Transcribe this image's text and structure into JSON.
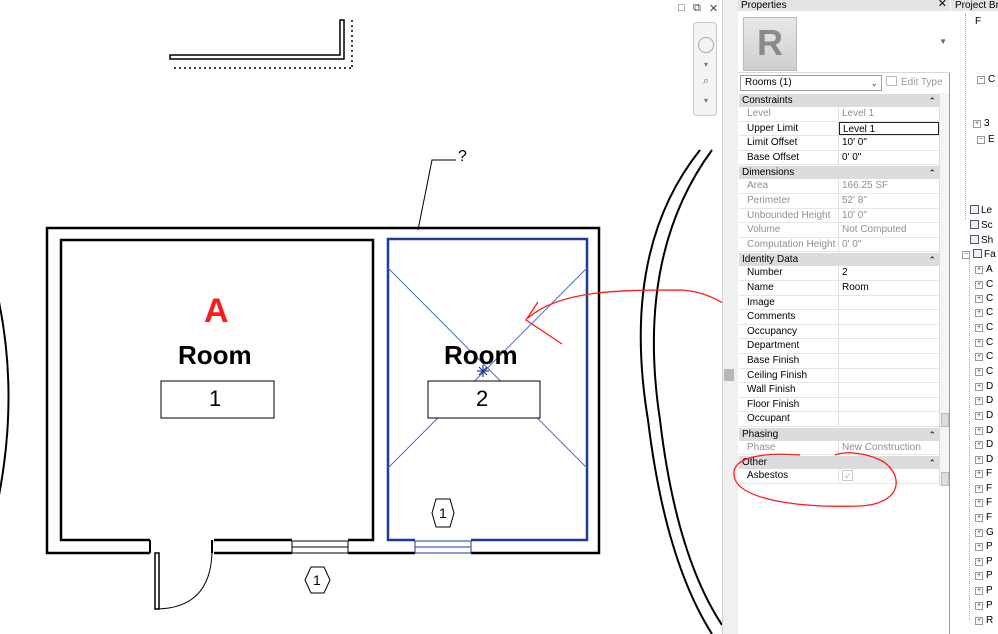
{
  "canvas": {
    "tag_letter": "A",
    "question_mark": "?",
    "rooms": [
      {
        "name": "Room",
        "number": "1"
      },
      {
        "name": "Room",
        "number": "2"
      }
    ],
    "door_tags": [
      "1",
      "1"
    ]
  },
  "window_controls": [
    "□",
    "⧉",
    "✕"
  ],
  "properties": {
    "title": "Properties",
    "close": "✕",
    "logo_letter": "R",
    "type_selector": "Rooms (1)",
    "edit_type": "Edit Type",
    "groups": [
      {
        "label": "Constraints",
        "rows": [
          {
            "key": "Level",
            "value": "Level 1",
            "readonly": true
          },
          {
            "key": "Upper Limit",
            "value": "Level 1",
            "readonly": false,
            "editing": true
          },
          {
            "key": "Limit Offset",
            "value": "10'  0\"",
            "readonly": false
          },
          {
            "key": "Base Offset",
            "value": "0'  0\"",
            "readonly": false
          }
        ]
      },
      {
        "label": "Dimensions",
        "rows": [
          {
            "key": "Area",
            "value": "166.25 SF",
            "readonly": true
          },
          {
            "key": "Perimeter",
            "value": "52'  8\"",
            "readonly": true
          },
          {
            "key": "Unbounded Height",
            "value": "10'  0\"",
            "readonly": true
          },
          {
            "key": "Volume",
            "value": "Not Computed",
            "readonly": true
          },
          {
            "key": "Computation Height",
            "value": "0'  0\"",
            "readonly": true
          }
        ]
      },
      {
        "label": "Identity Data",
        "rows": [
          {
            "key": "Number",
            "value": "2",
            "readonly": false
          },
          {
            "key": "Name",
            "value": "Room",
            "readonly": false
          },
          {
            "key": "Image",
            "value": "",
            "readonly": false
          },
          {
            "key": "Comments",
            "value": "",
            "readonly": false
          },
          {
            "key": "Occupancy",
            "value": "",
            "readonly": false
          },
          {
            "key": "Department",
            "value": "",
            "readonly": false
          },
          {
            "key": "Base Finish",
            "value": "",
            "readonly": false
          },
          {
            "key": "Ceiling Finish",
            "value": "",
            "readonly": false
          },
          {
            "key": "Wall Finish",
            "value": "",
            "readonly": false
          },
          {
            "key": "Floor Finish",
            "value": "",
            "readonly": false
          },
          {
            "key": "Occupant",
            "value": "",
            "readonly": false
          }
        ]
      },
      {
        "label": "Phasing",
        "rows": [
          {
            "key": "Phase",
            "value": "New Construction",
            "readonly": true
          }
        ]
      },
      {
        "label": "Other",
        "rows": [
          {
            "key": "Asbestos",
            "value": "",
            "readonly": false,
            "checkbox": true,
            "checked": true
          }
        ]
      }
    ]
  },
  "browser": {
    "title": "Project Bro",
    "items": [
      {
        "label": "F",
        "expander": "",
        "icon": false
      },
      {
        "label": "C",
        "expander": "−",
        "icon": false
      },
      {
        "label": "3",
        "expander": "+",
        "icon": false
      },
      {
        "label": "E",
        "expander": "−",
        "icon": false
      },
      {
        "label": "Le",
        "expander": "",
        "icon": true
      },
      {
        "label": "Sc",
        "expander": "",
        "icon": true
      },
      {
        "label": "Sh",
        "expander": "",
        "icon": true
      },
      {
        "label": "Fa",
        "expander": "−",
        "icon": true
      },
      {
        "label": "A",
        "expander": "+",
        "icon": false
      },
      {
        "label": "C",
        "expander": "+",
        "icon": false
      },
      {
        "label": "C",
        "expander": "+",
        "icon": false
      },
      {
        "label": "C",
        "expander": "+",
        "icon": false
      },
      {
        "label": "C",
        "expander": "+",
        "icon": false
      },
      {
        "label": "C",
        "expander": "+",
        "icon": false
      },
      {
        "label": "C",
        "expander": "+",
        "icon": false
      },
      {
        "label": "C",
        "expander": "+",
        "icon": false
      },
      {
        "label": "D",
        "expander": "+",
        "icon": false
      },
      {
        "label": "D",
        "expander": "+",
        "icon": false
      },
      {
        "label": "D",
        "expander": "+",
        "icon": false
      },
      {
        "label": "D",
        "expander": "+",
        "icon": false
      },
      {
        "label": "D",
        "expander": "+",
        "icon": false
      },
      {
        "label": "D",
        "expander": "+",
        "icon": false
      },
      {
        "label": "F",
        "expander": "+",
        "icon": false
      },
      {
        "label": "F",
        "expander": "+",
        "icon": false
      },
      {
        "label": "F",
        "expander": "+",
        "icon": false
      },
      {
        "label": "F",
        "expander": "+",
        "icon": false
      },
      {
        "label": "G",
        "expander": "+",
        "icon": false
      },
      {
        "label": "P",
        "expander": "+",
        "icon": false
      },
      {
        "label": "P",
        "expander": "+",
        "icon": false
      },
      {
        "label": "P",
        "expander": "+",
        "icon": false
      },
      {
        "label": "P",
        "expander": "+",
        "icon": false
      },
      {
        "label": "P",
        "expander": "+",
        "icon": false
      },
      {
        "label": "R",
        "expander": "+",
        "icon": false
      }
    ]
  },
  "colors": {
    "selection_blue": "#1f3a93",
    "markup_red": "#ff1a1a",
    "group_header": "#dcdcdc"
  }
}
